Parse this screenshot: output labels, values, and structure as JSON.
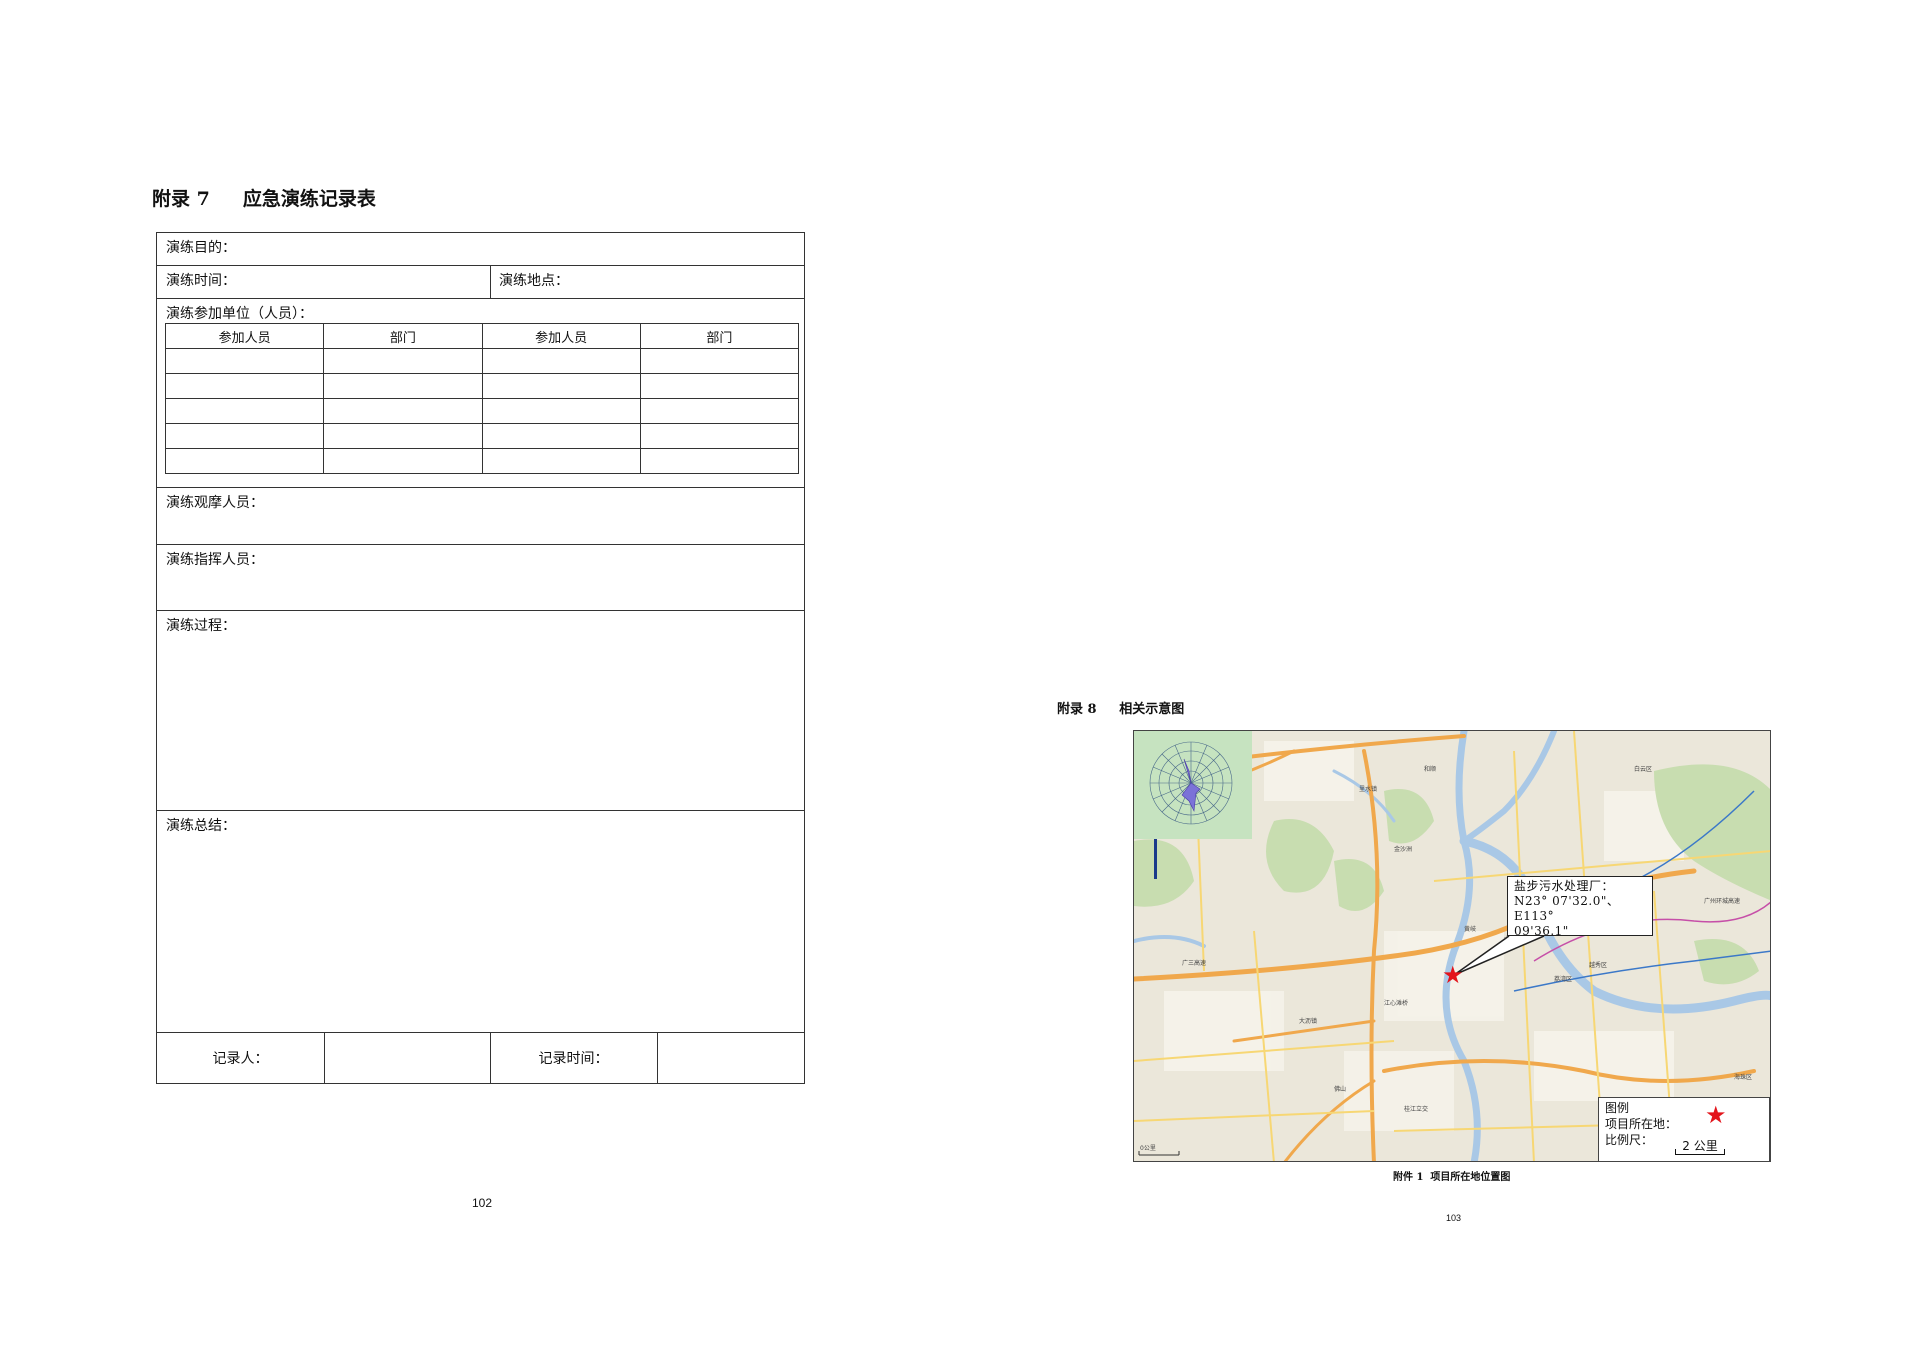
{
  "left_page": {
    "appendix_title": "附录 7     应急演练记录表",
    "form": {
      "purpose": "演练目的：",
      "time": "演练时间：",
      "location": "演练地点：",
      "units": "演练参加单位（人员）：",
      "table_headers": [
        "参加人员",
        "部门",
        "参加人员",
        "部门"
      ],
      "observers": "演练观摩人员：",
      "commanders": "演练指挥人员：",
      "process": "演练过程：",
      "summary": "演练总结：",
      "recorder": "记录人：",
      "record_time": "记录时间："
    },
    "page_number": "102"
  },
  "right_page": {
    "appendix_title": "附录 8     相关示意图",
    "callout": {
      "line1": "盐步污水处理厂：",
      "line2": "N23° 07'32.0\"、E113°",
      "line3": "09'36.1\""
    },
    "legend": {
      "title": "图例",
      "site": "项目所在地：",
      "scale_label": "比例尺：",
      "scale_value": "2 公里"
    },
    "map_labels": [
      "广三高速",
      "大沥镇",
      "江心滩桥",
      "佛山",
      "桂江立交",
      "荔湾区",
      "越秀区",
      "海珠区",
      "白云区",
      "大坦沙",
      "金沙洲",
      "里水镇",
      "广州环城高速",
      "黄岐",
      "和顺"
    ],
    "map_scale_small": "0公里",
    "accent_color": "#e3141b",
    "figure_caption": "附件 1  项目所在地位置图",
    "page_number": "103"
  }
}
